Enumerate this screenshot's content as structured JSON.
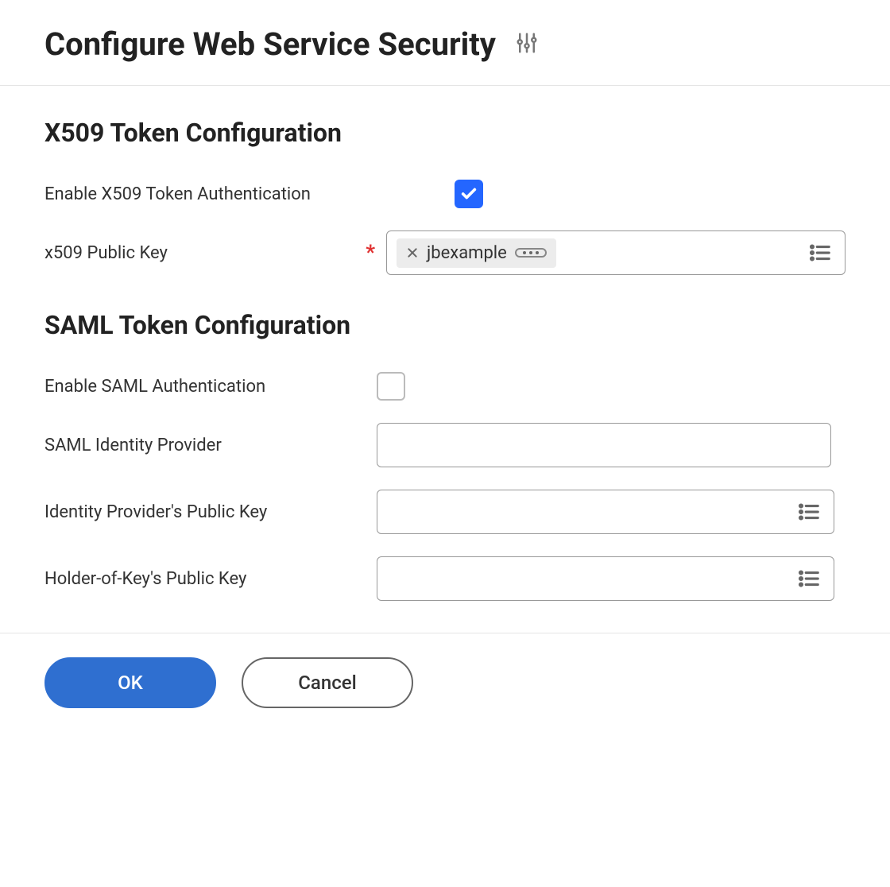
{
  "header": {
    "title": "Configure Web Service Security"
  },
  "sections": {
    "x509": {
      "title": "X509 Token Configuration",
      "enable_label": "Enable X509 Token Authentication",
      "enable_checked": true,
      "public_key_label": "x509 Public Key",
      "public_key_required": true,
      "public_key_value": "jbexample"
    },
    "saml": {
      "title": "SAML Token Configuration",
      "enable_label": "Enable SAML Authentication",
      "enable_checked": false,
      "idp_label": "SAML Identity Provider",
      "idp_value": "",
      "idp_public_key_label": "Identity Provider's Public Key",
      "idp_public_key_value": "",
      "hok_public_key_label": "Holder-of-Key's Public Key",
      "hok_public_key_value": ""
    }
  },
  "footer": {
    "ok_label": "OK",
    "cancel_label": "Cancel"
  },
  "glyphs": {
    "required": "*"
  }
}
